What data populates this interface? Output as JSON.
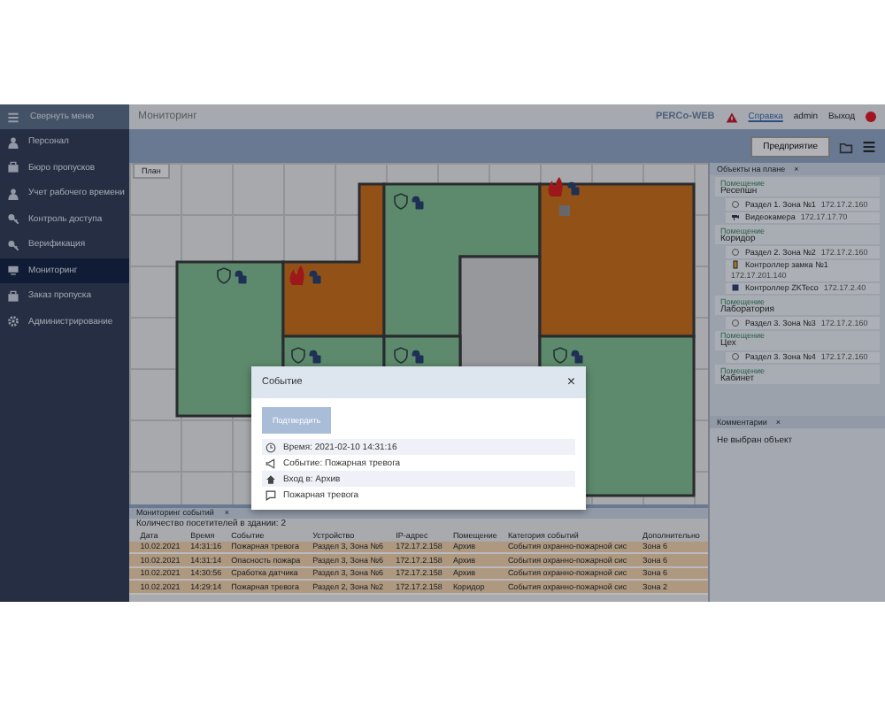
{
  "header": {
    "menu_toggle": "Свернуть меню",
    "title": "Мониторинг",
    "brand": "PERCo-WEB",
    "help": "Справка",
    "user": "admin",
    "logout": "Выход"
  },
  "sidebar": {
    "items": [
      {
        "label": "Персонал",
        "selected": false
      },
      {
        "label": "Бюро пропусков",
        "selected": false
      },
      {
        "label": "Учет рабочего времени",
        "selected": false
      },
      {
        "label": "Контроль доступа",
        "selected": false
      },
      {
        "label": "Верификация",
        "selected": false
      },
      {
        "label": "Мониторинг",
        "selected": true
      },
      {
        "label": "Заказ пропуска",
        "selected": false
      },
      {
        "label": "Администрирование",
        "selected": false
      }
    ]
  },
  "toolbar": {
    "button": "Предприятие"
  },
  "plan": {
    "tab": "План",
    "rooms": [
      {
        "secured": true,
        "alarm": false
      },
      {
        "secured": true,
        "alarm": true
      },
      {
        "secured": true,
        "alarm": false
      },
      {
        "secured": false,
        "alarm": false
      },
      {
        "secured": true,
        "alarm": true
      },
      {
        "secured": true,
        "alarm": false
      },
      {
        "secured": true,
        "alarm": false
      },
      {
        "secured": true,
        "alarm": false
      }
    ]
  },
  "objects": {
    "title": "Объекты на плане",
    "groups": [
      {
        "kind_label": "Помещение",
        "name": "Ресепшн",
        "items": [
          {
            "kind": "zone",
            "label": "Раздел 1. Зона №1",
            "ip": "172.17.2.160"
          },
          {
            "kind": "camera",
            "label": "Видеокамера",
            "ip": "172.17.17.70"
          }
        ]
      },
      {
        "kind_label": "Помещение",
        "name": "Коридор",
        "items": [
          {
            "kind": "zone",
            "label": "Раздел 2. Зона №2",
            "ip": "172.17.2.160"
          },
          {
            "kind": "lock",
            "label": "Контроллер замка №1",
            "ip": "172.17.201.140"
          },
          {
            "kind": "controller",
            "label": "Контроллер ZKTeco",
            "ip": "172.17.2.40"
          }
        ]
      },
      {
        "kind_label": "Помещение",
        "name": "Лаборатория",
        "items": [
          {
            "kind": "zone",
            "label": "Раздел 3. Зона №3",
            "ip": "172.17.2.160"
          }
        ]
      },
      {
        "kind_label": "Помещение",
        "name": "Цех",
        "items": [
          {
            "kind": "zone",
            "label": "Раздел 3. Зона №4",
            "ip": "172.17.2.160"
          }
        ]
      },
      {
        "kind_label": "Помещение",
        "name": "Кабинет"
      }
    ],
    "close": "×"
  },
  "comments": {
    "title": "Комментарии",
    "close": "×",
    "empty": "Не выбран объект"
  },
  "events": {
    "tab": "Мониторинг событий",
    "close": "×",
    "visitors": "Количество посетителей в здании: 2",
    "columns": [
      "Дата",
      "Время",
      "Событие",
      "Устройство",
      "IP-адрес",
      "Помещение",
      "Категория событий",
      "Дополнительно"
    ],
    "rows": [
      [
        "10.02.2021",
        "14:31:16",
        "Пожарная тревога",
        "Раздел 3, Зона №6",
        "172.17.2.158",
        "Архив",
        "События охранно-пожарной сис",
        "Зона 6"
      ],
      [
        "10.02.2021",
        "14:31:14",
        "Опасность пожара",
        "Раздел 3, Зона №6",
        "172.17.2.158",
        "Архив",
        "События охранно-пожарной сис",
        "Зона 6"
      ],
      [
        "10.02.2021",
        "14:30:56",
        "Сработка датчика",
        "Раздел 3, Зона №6",
        "172.17.2.158",
        "Архив",
        "События охранно-пожарной сис",
        "Зона 6"
      ],
      [
        "10.02.2021",
        "14:29:14",
        "Пожарная тревога",
        "Раздел 2, Зона №2",
        "172.17.2.158",
        "Коридор",
        "События охранно-пожарной сис",
        "Зона 2"
      ]
    ]
  },
  "dialog": {
    "title": "Событие",
    "close": "×",
    "button": "Подтвердить",
    "button_disabled": true,
    "lines": [
      {
        "kind": "time",
        "text": "Время: 2021-02-10 14:31:16"
      },
      {
        "kind": "event",
        "text": "Событие: Пожарная тревога"
      },
      {
        "kind": "entry",
        "text": "Вход в: Архив"
      },
      {
        "kind": "comment",
        "text": "Пожарная тревога"
      }
    ]
  }
}
